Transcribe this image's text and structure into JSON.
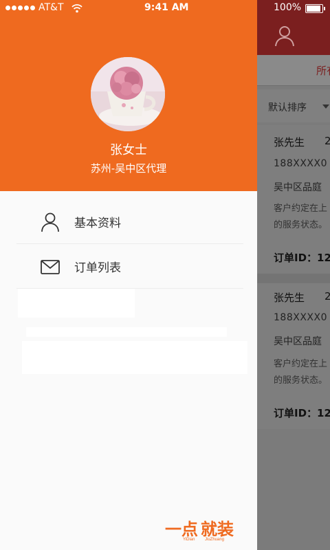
{
  "status_bar": {
    "carrier": "AT&T",
    "time": "9:41 AM",
    "battery": "100%"
  },
  "drawer": {
    "user_name": "张女士",
    "user_region": "苏州-吴中区代理",
    "menu": [
      {
        "label": "基本资料",
        "icon": "user-icon"
      },
      {
        "label": "订单列表",
        "icon": "mail-icon"
      }
    ],
    "brand": {
      "logo_text_1": "一点",
      "logo_text_2": "就装",
      "logo_sub_1": "YiDian",
      "logo_sub_2": "JiuZhuang"
    }
  },
  "background_page": {
    "tab_label": "所有",
    "sort_label": "默认排序",
    "orders": [
      {
        "name": "张先生",
        "number": "2",
        "phone": "188XXXX0",
        "address": "吴中区品庭",
        "desc_line1": "客户约定在上",
        "desc_line2": "的服务状态。",
        "order_id": "订单ID：12"
      },
      {
        "name": "张先生",
        "number": "2",
        "phone": "188XXXX0",
        "address": "吴中区品庭",
        "desc_line1": "客户约定在上",
        "desc_line2": "的服务状态。",
        "order_id": "订单ID：12"
      }
    ]
  },
  "colors": {
    "drawer_header": "#ef6a1f",
    "app_header": "#7b1f1f",
    "overlay": "#7b7b7b"
  }
}
